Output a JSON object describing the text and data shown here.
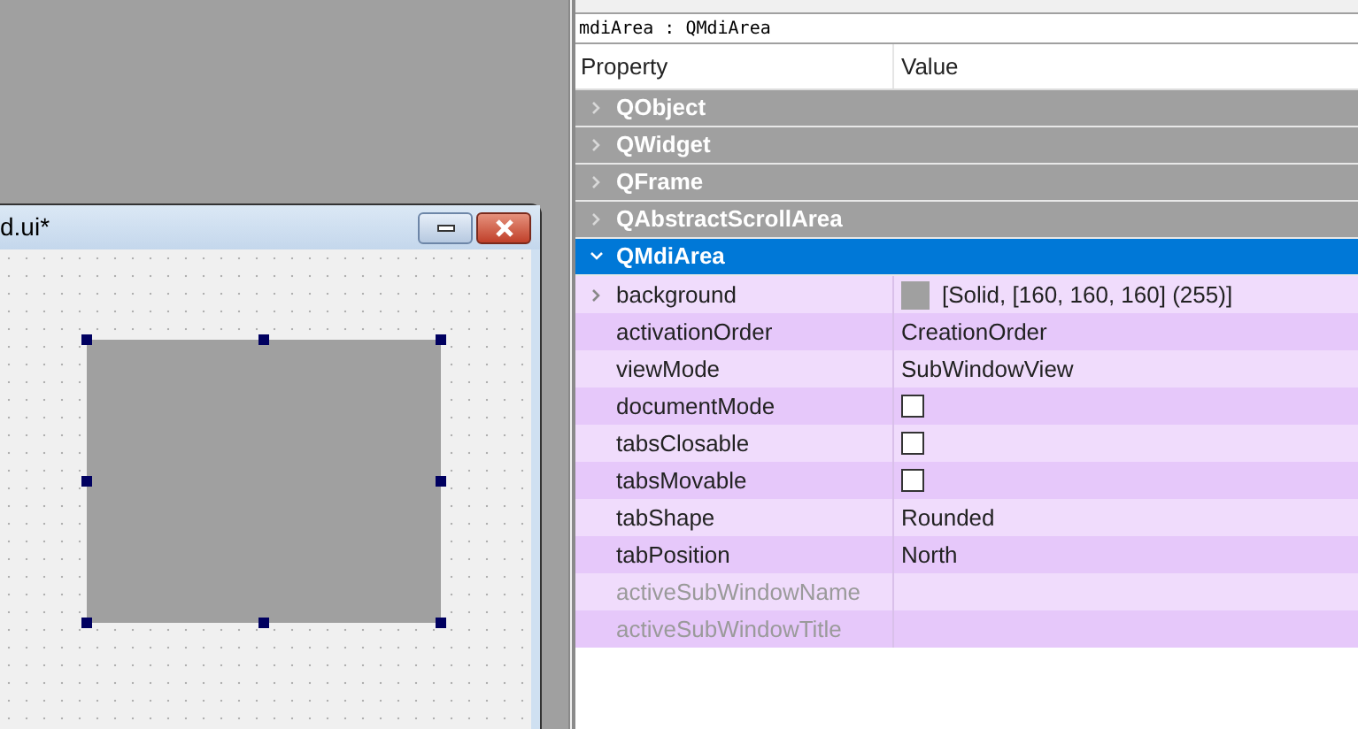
{
  "form_window": {
    "title": "d.ui*"
  },
  "property_editor": {
    "object_label": "mdiArea : QMdiArea",
    "columns": [
      "Property",
      "Value"
    ],
    "rows": [
      {
        "kind": "group",
        "name": "QObject",
        "expanded": false,
        "selected": false
      },
      {
        "kind": "group",
        "name": "QWidget",
        "expanded": false,
        "selected": false
      },
      {
        "kind": "group",
        "name": "QFrame",
        "expanded": false,
        "selected": false
      },
      {
        "kind": "group",
        "name": "QAbstractScrollArea",
        "expanded": false,
        "selected": false
      },
      {
        "kind": "group",
        "name": "QMdiArea",
        "expanded": true,
        "selected": true
      },
      {
        "kind": "color",
        "name": "background",
        "value": "[Solid, [160, 160, 160] (255)]",
        "color": "#a0a0a0",
        "expandable": true,
        "disabled": false
      },
      {
        "kind": "text",
        "name": "activationOrder",
        "value": "CreationOrder",
        "disabled": false
      },
      {
        "kind": "text",
        "name": "viewMode",
        "value": "SubWindowView",
        "disabled": false
      },
      {
        "kind": "checkbox",
        "name": "documentMode",
        "checked": false,
        "disabled": false
      },
      {
        "kind": "checkbox",
        "name": "tabsClosable",
        "checked": false,
        "disabled": false
      },
      {
        "kind": "checkbox",
        "name": "tabsMovable",
        "checked": false,
        "disabled": false
      },
      {
        "kind": "text",
        "name": "tabShape",
        "value": "Rounded",
        "disabled": false
      },
      {
        "kind": "text",
        "name": "tabPosition",
        "value": "North",
        "disabled": false
      },
      {
        "kind": "text",
        "name": "activeSubWindowName",
        "disabled": true
      },
      {
        "kind": "text",
        "name": "activeSubWindowTitle",
        "disabled": true
      }
    ]
  }
}
